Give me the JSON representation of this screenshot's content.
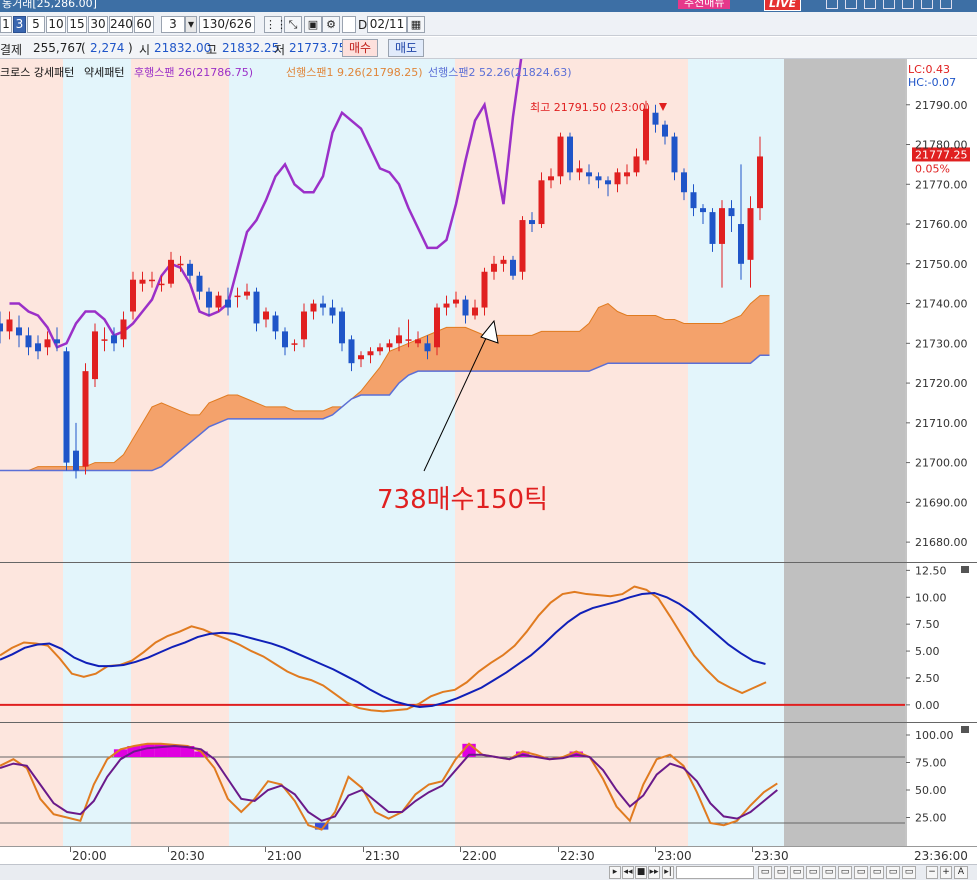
{
  "window": {
    "title": "동거래[25,286.00]",
    "ad_label": "추천매뉴",
    "live_label": "LIVE",
    "controls": [
      "□",
      "▣",
      "▤",
      "?",
      "—",
      "□",
      "✕"
    ]
  },
  "toolbar": {
    "period_buttons": [
      "1",
      "3",
      "5",
      "10",
      "15",
      "30",
      "240",
      "60"
    ],
    "selected_period": "3",
    "interval_value": "3",
    "count_display": "130/626",
    "d_label": "D",
    "date_value": "02/11"
  },
  "price": {
    "contract_label": "결제",
    "volume": "255,767",
    "change": "2,274",
    "paren_open": "(",
    "paren_close": ")",
    "open_label": "시",
    "open": "21832.00",
    "high_label": "고",
    "high": "21832.25",
    "low_label": "저",
    "low": "21773.75",
    "buy_button": "매수",
    "sell_button": "매도"
  },
  "legend": {
    "items": [
      {
        "text": "크로스 강세패턴",
        "color": "#111111"
      },
      {
        "text": "약세패턴",
        "color": "#111111"
      },
      {
        "text": "후행스팬 26(21786.75)",
        "color": "#9b30c8"
      },
      {
        "text": "선행스팬1 9.26(21798.25)",
        "color": "#e0863a"
      },
      {
        "text": "선행스팬2 52.26(21824.63)",
        "color": "#5b6fd6"
      }
    ],
    "lc_label": "LC:0.43",
    "hc_label": "HC:-0.07"
  },
  "annotations": {
    "high_marker": "최고 21791.50 (23:00)",
    "trade_note": "738매수150틱"
  },
  "current_price": {
    "value": "21777.25",
    "change_pct": "0.05%"
  },
  "colors": {
    "up": "#e02020",
    "down": "#1f55c8",
    "cloud": "#f4a26b",
    "lagging": "#9b30c8",
    "span2": "#5b6fd6",
    "band_pink": "#fde6de",
    "band_blue": "#e3f5fb",
    "osc_orange": "#e07b20",
    "osc_blue": "#1020b8",
    "zero_line": "#e02020",
    "stoch_fill": "#e000e0",
    "stoch_fill_low": "#3a4fd8"
  },
  "chart_data": {
    "type": "candlestick",
    "time_labels": [
      "20:00",
      "20:30",
      "21:00",
      "21:30",
      "22:00",
      "22:30",
      "23:00",
      "23:30"
    ],
    "last_time_label": "23:36:00",
    "price_axis": {
      "ticks": [
        "21790.00",
        "21780.00",
        "21770.00",
        "21760.00",
        "21750.00",
        "21740.00",
        "21730.00",
        "21720.00",
        "21710.00",
        "21700.00",
        "21690.00",
        "21680.00"
      ],
      "min": 21675,
      "max": 21800
    },
    "osc_axis": {
      "ticks": [
        "12.50",
        "10.00",
        "7.50",
        "5.00",
        "2.50",
        "0.00"
      ],
      "min": -1.5,
      "max": 13
    },
    "stoch_axis": {
      "ticks": [
        "100.00",
        "75.00",
        "50.00",
        "25.00"
      ],
      "min": 0,
      "max": 110
    },
    "candles": [
      [
        21735,
        21733,
        21738,
        21730
      ],
      [
        21733,
        21736,
        21738,
        21731
      ],
      [
        21734,
        21732,
        21737,
        21729
      ],
      [
        21732,
        21729,
        21734,
        21727
      ],
      [
        21730,
        21728,
        21732,
        21726
      ],
      [
        21729,
        21731,
        21733,
        21727
      ],
      [
        21731,
        21730,
        21734,
        21728
      ],
      [
        21728,
        21700,
        21729,
        21698
      ],
      [
        21703,
        21698,
        21710,
        21696
      ],
      [
        21699,
        21723,
        21725,
        21697
      ],
      [
        21721,
        21733,
        21735,
        21719
      ],
      [
        21731,
        21731,
        21734,
        21728
      ],
      [
        21732,
        21730,
        21734,
        21728
      ],
      [
        21731,
        21736,
        21738,
        21729
      ],
      [
        21738,
        21746,
        21748,
        21736
      ],
      [
        21745,
        21746,
        21748,
        21743
      ],
      [
        21746,
        21746,
        21748,
        21744
      ],
      [
        21745,
        21745,
        21747,
        21743
      ],
      [
        21745,
        21751,
        21753,
        21744
      ],
      [
        21750,
        21750,
        21752,
        21748
      ],
      [
        21750,
        21747,
        21751,
        21745
      ],
      [
        21747,
        21743,
        21748,
        21741
      ],
      [
        21743,
        21739,
        21744,
        21737
      ],
      [
        21739,
        21742,
        21743,
        21738
      ],
      [
        21741,
        21739,
        21744,
        21737
      ],
      [
        21742,
        21742,
        21744,
        21739
      ],
      [
        21742,
        21743,
        21745,
        21741
      ],
      [
        21743,
        21735,
        21744,
        21733
      ],
      [
        21736,
        21738,
        21739,
        21734
      ],
      [
        21737,
        21733,
        21738,
        21731
      ],
      [
        21733,
        21729,
        21734,
        21727
      ],
      [
        21730,
        21730,
        21731,
        21728
      ],
      [
        21731,
        21738,
        21740,
        21729
      ],
      [
        21738,
        21740,
        21741,
        21736
      ],
      [
        21740,
        21739,
        21742,
        21737
      ],
      [
        21739,
        21737,
        21741,
        21735
      ],
      [
        21738,
        21730,
        21739,
        21728
      ],
      [
        21731,
        21725,
        21732,
        21723
      ],
      [
        21726,
        21727,
        21728,
        21724
      ],
      [
        21727,
        21728,
        21729,
        21725
      ],
      [
        21728,
        21729,
        21730,
        21727
      ],
      [
        21729,
        21730,
        21731,
        21728
      ],
      [
        21730,
        21732,
        21734,
        21728
      ],
      [
        21731,
        21731,
        21736,
        21729
      ],
      [
        21730,
        21731,
        21733,
        21729
      ],
      [
        21730,
        21728,
        21732,
        21726
      ],
      [
        21729,
        21739,
        21740,
        21727
      ],
      [
        21739,
        21740,
        21742,
        21737
      ],
      [
        21740,
        21741,
        21743,
        21739
      ],
      [
        21741,
        21737,
        21742,
        21735
      ],
      [
        21737,
        21739,
        21741,
        21736
      ],
      [
        21739,
        21748,
        21749,
        21737
      ],
      [
        21748,
        21750,
        21752,
        21746
      ],
      [
        21750,
        21751,
        21752,
        21748
      ],
      [
        21751,
        21747,
        21752,
        21746
      ],
      [
        21748,
        21761,
        21762,
        21746
      ],
      [
        21761,
        21760,
        21763,
        21758
      ],
      [
        21760,
        21771,
        21773,
        21759
      ],
      [
        21771,
        21772,
        21774,
        21769
      ],
      [
        21772,
        21782,
        21783,
        21770
      ],
      [
        21782,
        21773,
        21783,
        21771
      ],
      [
        21773,
        21774,
        21776,
        21771
      ],
      [
        21773,
        21772,
        21775,
        21770
      ],
      [
        21772,
        21771,
        21773,
        21769
      ],
      [
        21771,
        21770,
        21772,
        21767
      ],
      [
        21770,
        21773,
        21774,
        21768
      ],
      [
        21772,
        21773,
        21775,
        21770
      ],
      [
        21773,
        21777,
        21779,
        21772
      ],
      [
        21776,
        21789,
        21791,
        21775
      ],
      [
        21788,
        21785,
        21790,
        21783
      ],
      [
        21785,
        21782,
        21786,
        21780
      ],
      [
        21782,
        21773,
        21783,
        21771
      ],
      [
        21773,
        21768,
        21774,
        21766
      ],
      [
        21768,
        21764,
        21770,
        21762
      ],
      [
        21764,
        21763,
        21765,
        21760
      ],
      [
        21763,
        21755,
        21764,
        21753
      ],
      [
        21755,
        21764,
        21766,
        21744
      ],
      [
        21764,
        21762,
        21766,
        21758
      ],
      [
        21760,
        21750,
        21775,
        21746
      ],
      [
        21751,
        21764,
        21767,
        21744
      ],
      [
        21764,
        21777,
        21782,
        21761
      ]
    ],
    "lagging_span": [
      21740,
      21740,
      21738,
      21737,
      21734,
      21729,
      21730,
      21735,
      21738,
      21738,
      21736,
      21732,
      21733,
      21735,
      21738,
      21741,
      21747,
      21750,
      21749,
      21745,
      21738,
      21737,
      21738,
      21740,
      21749,
      21758,
      21761,
      21766,
      21772,
      21775,
      21770,
      21768,
      21768,
      21772,
      21783,
      21788,
      21786,
      21784,
      21779,
      21774,
      21773,
      21770,
      21764,
      21759,
      21754,
      21754,
      21756,
      21765,
      21776,
      21786,
      21790,
      21778,
      21765,
      21787,
      21804
    ],
    "span1": [
      21698,
      21698,
      21698,
      21698,
      21699,
      21699,
      21699,
      21699,
      21699,
      21699,
      21700,
      21700,
      21700,
      21702,
      21706,
      21710,
      21714,
      21715,
      21714,
      21713,
      21712,
      21712,
      21715,
      21716,
      21717,
      21717,
      21716,
      21715,
      21714,
      21714,
      21714,
      21713,
      21713,
      21713,
      21713,
      21714,
      21714,
      21716,
      21718,
      21721,
      21724,
      21728,
      21729,
      21730,
      21731,
      21732,
      21733,
      21734,
      21734,
      21734,
      21733,
      21732,
      21732,
      21732,
      21732,
      21732,
      21732,
      21733,
      21733,
      21733,
      21733,
      21733,
      21735,
      21739,
      21740,
      21738,
      21737,
      21737,
      21737,
      21737,
      21736,
      21736,
      21735,
      21735,
      21735,
      21735,
      21735,
      21736,
      21737,
      21740,
      21742,
      21742
    ],
    "span2": [
      21698,
      21698,
      21698,
      21698,
      21698,
      21698,
      21698,
      21698,
      21698,
      21698,
      21698,
      21698,
      21698,
      21698,
      21698,
      21698,
      21698,
      21699,
      21701,
      21703,
      21705,
      21707,
      21709,
      21710,
      21711,
      21711,
      21711,
      21711,
      21711,
      21711,
      21711,
      21711,
      21711,
      21711,
      21711,
      21712,
      21714,
      21716,
      21717,
      21717,
      21717,
      21717,
      21720,
      21722,
      21723,
      21723,
      21723,
      21723,
      21723,
      21723,
      21723,
      21723,
      21723,
      21723,
      21723,
      21723,
      21723,
      21723,
      21723,
      21723,
      21723,
      21723,
      21723,
      21724,
      21725,
      21725,
      21725,
      21725,
      21725,
      21725,
      21725,
      21725,
      21725,
      21725,
      21725,
      21725,
      21725,
      21725,
      21725,
      21725,
      21727,
      21727
    ],
    "oscillator": {
      "fast": [
        4.6,
        5.3,
        5.8,
        5.7,
        5.5,
        4.3,
        2.9,
        2.6,
        2.9,
        3.6,
        3.7,
        4.1,
        4.9,
        5.8,
        6.4,
        6.8,
        7.3,
        7.0,
        6.5,
        6.1,
        5.6,
        5.0,
        4.5,
        3.8,
        3.1,
        2.6,
        2.3,
        1.8,
        1.0,
        0.2,
        -0.3,
        -0.5,
        -0.6,
        -0.5,
        -0.4,
        0.1,
        0.8,
        1.2,
        1.4,
        2.1,
        3.1,
        3.9,
        4.6,
        5.5,
        6.8,
        8.3,
        9.5,
        10.3,
        10.5,
        10.3,
        10.2,
        10.1,
        10.3,
        11.0,
        10.7,
        9.9,
        8.2,
        6.4,
        4.6,
        3.3,
        2.2,
        1.6,
        1.1,
        1.6,
        2.1
      ],
      "slow": [
        4.2,
        4.7,
        5.3,
        5.6,
        5.7,
        5.2,
        4.4,
        3.9,
        3.6,
        3.6,
        3.7,
        4.0,
        4.4,
        4.9,
        5.4,
        5.8,
        6.3,
        6.6,
        6.7,
        6.6,
        6.3,
        6.0,
        5.7,
        5.3,
        4.8,
        4.3,
        3.8,
        3.3,
        2.7,
        2.1,
        1.4,
        0.8,
        0.3,
        0.0,
        -0.2,
        -0.1,
        0.2,
        0.6,
        1.1,
        1.6,
        2.3,
        3.0,
        3.8,
        4.6,
        5.6,
        6.7,
        7.7,
        8.5,
        9.0,
        9.3,
        9.6,
        10.0,
        10.3,
        10.4,
        10.0,
        9.4,
        8.6,
        7.6,
        6.6,
        5.6,
        4.8,
        4.1,
        3.8
      ]
    },
    "stochastic": {
      "k": [
        72,
        78,
        70,
        42,
        28,
        25,
        22,
        55,
        78,
        87,
        90,
        92,
        92,
        91,
        90,
        85,
        70,
        42,
        30,
        42,
        58,
        55,
        40,
        18,
        14,
        30,
        62,
        52,
        30,
        24,
        30,
        46,
        55,
        58,
        78,
        92,
        82,
        80,
        78,
        85,
        82,
        78,
        80,
        85,
        80,
        60,
        35,
        22,
        55,
        78,
        82,
        72,
        48,
        20,
        18,
        22,
        36,
        48,
        56
      ],
      "d": [
        70,
        74,
        72,
        55,
        38,
        30,
        28,
        40,
        62,
        78,
        85,
        88,
        89,
        90,
        89,
        87,
        78,
        60,
        42,
        40,
        50,
        54,
        46,
        30,
        22,
        26,
        45,
        50,
        40,
        30,
        30,
        40,
        48,
        54,
        68,
        82,
        82,
        80,
        78,
        82,
        80,
        78,
        79,
        82,
        80,
        68,
        50,
        35,
        45,
        64,
        74,
        70,
        58,
        38,
        26,
        24,
        30,
        40,
        50
      ]
    }
  }
}
